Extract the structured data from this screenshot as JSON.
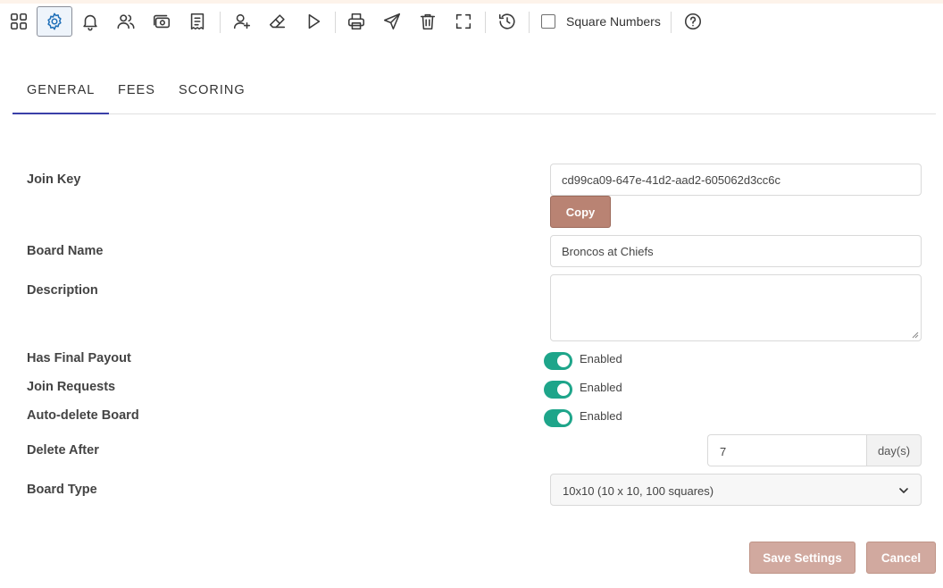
{
  "toolbar": {
    "square_numbers_label": "Square Numbers",
    "square_numbers_checked": false,
    "icons": [
      "grid-icon",
      "gear-icon",
      "bell-icon",
      "users-icon",
      "money-icon",
      "receipt-icon",
      "add-user-icon",
      "eraser-icon",
      "play-icon",
      "printer-icon",
      "send-icon",
      "trash-icon",
      "fullscreen-icon",
      "history-icon",
      "help-icon"
    ],
    "active_icon": "gear-icon"
  },
  "tabs": [
    {
      "label": "GENERAL",
      "active": true
    },
    {
      "label": "FEES",
      "active": false
    },
    {
      "label": "SCORING",
      "active": false
    }
  ],
  "form": {
    "join_key": {
      "label": "Join Key",
      "value": "cd99ca09-647e-41d2-aad2-605062d3cc6c",
      "copy_label": "Copy"
    },
    "board_name": {
      "label": "Board Name",
      "value": "Broncos at Chiefs"
    },
    "description": {
      "label": "Description",
      "value": ""
    },
    "has_final_payout": {
      "label": "Has Final Payout",
      "state": "Enabled"
    },
    "join_requests": {
      "label": "Join Requests",
      "state": "Enabled"
    },
    "auto_delete": {
      "label": "Auto-delete Board",
      "state": "Enabled"
    },
    "delete_after": {
      "label": "Delete After",
      "value": "7",
      "unit": "day(s)"
    },
    "board_type": {
      "label": "Board Type",
      "value": "10x10 (10 x 10, 100 squares)"
    }
  },
  "actions": {
    "save_label": "Save Settings",
    "cancel_label": "Cancel"
  },
  "colors": {
    "accent_tab": "#3a3fa8",
    "toggle_on": "#1ea58a",
    "button_primary": "#b98373",
    "button_muted": "#d1a99f"
  }
}
